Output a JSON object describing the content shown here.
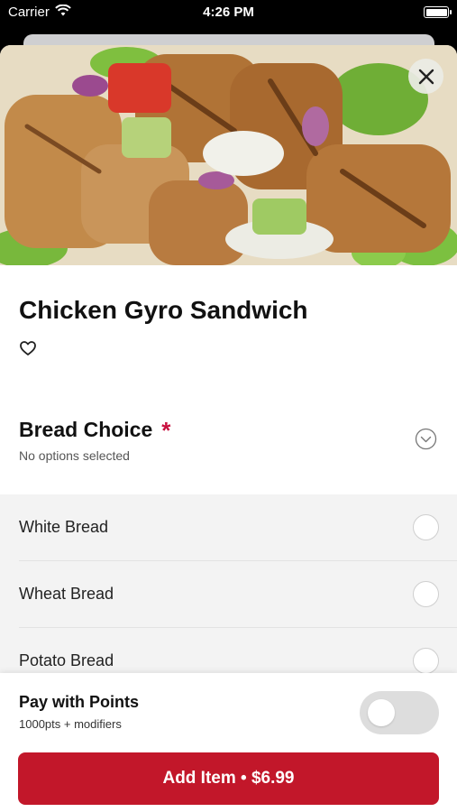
{
  "status_bar": {
    "carrier": "Carrier",
    "time": "4:26 PM"
  },
  "item": {
    "title": "Chicken Gyro Sandwich"
  },
  "bread_choice": {
    "title": "Bread Choice",
    "required_marker": "*",
    "subtitle": "No options selected",
    "options": [
      {
        "label": "White Bread"
      },
      {
        "label": "Wheat Bread"
      },
      {
        "label": "Potato Bread"
      }
    ]
  },
  "points": {
    "title": "Pay with Points",
    "subtitle": "1000pts + modifiers",
    "enabled": false
  },
  "add_button": {
    "label": "Add Item • $6.99"
  },
  "colors": {
    "brand_red": "#c2172a",
    "required_red": "#c8103e"
  },
  "icons": {
    "close": "close-icon",
    "favorite": "heart-outline-icon",
    "expand": "chevron-down-circle-icon",
    "wifi": "wifi-icon",
    "battery": "battery-icon"
  }
}
